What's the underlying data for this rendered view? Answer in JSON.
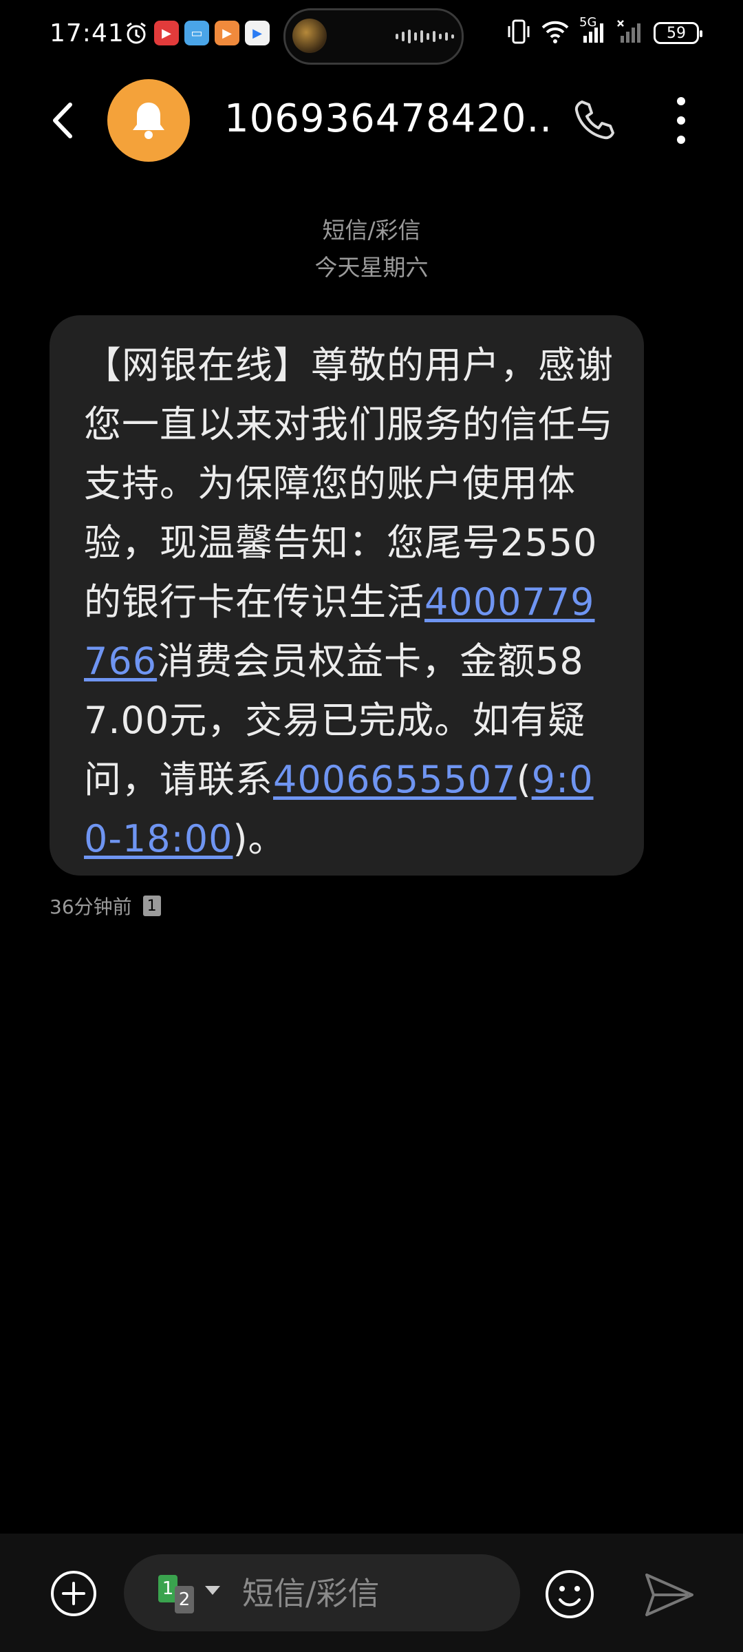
{
  "status_bar": {
    "time": "17:41",
    "network": "5G",
    "battery": "59",
    "icons": [
      "alarm-icon",
      "video-app-icon",
      "reader-app-icon",
      "media-app-icon",
      "game-app-icon",
      "vibrate-icon",
      "wifi-icon",
      "signal-icon"
    ]
  },
  "header": {
    "contact": "106936478420...",
    "avatar_icon": "bell-icon",
    "accent": "#f4a23a"
  },
  "thread": {
    "type_label": "短信/彩信",
    "date_label": "今天星期六"
  },
  "message": {
    "part1": "【网银在线】尊敬的用户，感谢您一直以来对我们服务的信任与支持。为保障您的账户使用体验，现温馨告知：您尾号2550的银行卡在传识生活",
    "link1": "4000779766",
    "part2": "消费会员权益卡，金额587.00元，交易已完成。如有疑问，请联系",
    "link2": "4006655507",
    "paren_open": "(",
    "link3": "9:00-18:00",
    "part3": ")。",
    "time_ago": "36分钟前",
    "sim": "1",
    "link_color": "#6f95f2"
  },
  "composer": {
    "placeholder": "短信/彩信",
    "sim1": "1",
    "sim2": "2"
  }
}
